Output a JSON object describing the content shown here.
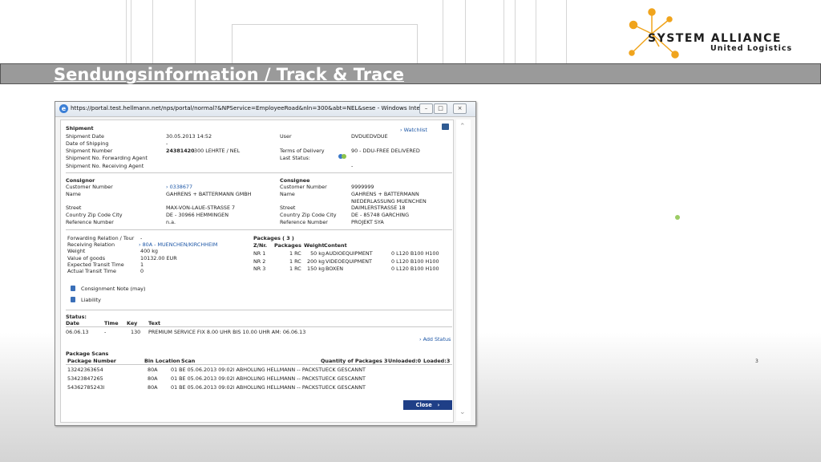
{
  "slide": {
    "title": "Sendungsinformation / Track & Trace",
    "logo": {
      "line1": "SYSTEM ALLIANCE",
      "line2": "United Logistics",
      "accent": "#f0a41c"
    },
    "tiny_text": "3"
  },
  "window": {
    "url": "https://portal.test.hellmann.net/nps/portal/normal?&NPService=EmployeeRoad&nln=300&abt=NEL&sese - Windows Inte...",
    "min": "–",
    "max": "□",
    "close": "×"
  },
  "shipment": {
    "heading": "Shipment",
    "links": {
      "watchlist": "Watchlist"
    },
    "labels": {
      "date": "Shipment Date",
      "shipping": "Date of Shipping",
      "number": "Shipment Number",
      "fwd": "Shipment No. Forwarding Agent",
      "rcv": "Shipment No. Receiving Agent",
      "user": "User",
      "terms": "Terms of Delivery",
      "last_status": "Last Status:"
    },
    "values": {
      "date": "30.05.2013  14:52",
      "shipping": "-",
      "number_bold": "24381420",
      "number_rest": "300 LEHRTE / NEL",
      "user": "DVDUEDVDUE",
      "terms": "90 - DDU-FREE DELIVERED",
      "last_status_dash": "-"
    }
  },
  "consignor": {
    "heading": "Consignor",
    "labels": {
      "customer": "Customer Number",
      "name": "Name",
      "street": "Street",
      "country": "Country Zip Code City",
      "reference": "Reference Number"
    },
    "values": {
      "customer": "0338677",
      "name": "GAHRENS + BATTERMANN GMBH",
      "street": "MAX-VON-LAUE-STRASSE 7",
      "country": "DE - 30966  HEMMINGEN",
      "reference": "n.a."
    }
  },
  "consignee": {
    "heading": "Consignee",
    "labels": {
      "customer": "Customer Number",
      "name": "Name",
      "street": "Street",
      "country": "Country Zip Code City",
      "reference": "Reference Number"
    },
    "values": {
      "customer": "9999999",
      "name1": "GAHRENS + BATTERMANN",
      "name2": "NIEDERLASSUNG MUENCHEN",
      "street": "DAIMLERSTRASSE 18",
      "country": "DE - 85748  GARCHING",
      "reference": "PROJEKT SYA"
    }
  },
  "forwarding": {
    "labels": {
      "relation": "Forwarding Relation / Tour",
      "receiving": "Receiving Relation",
      "weight": "Weight",
      "value": "Value of goods",
      "expected": "Expected Transit Time",
      "actual": "Actual Transit Time"
    },
    "values": {
      "relation": "-",
      "receiving": "80A - MUENCHEN/KIRCHHEIM",
      "weight": "400 kg",
      "value": "10132.00 EUR",
      "expected": "1",
      "actual": "0"
    }
  },
  "packages": {
    "heading": "Packages  ( 3 )",
    "headers": [
      "Z/Nr.",
      "Packages",
      "Weight",
      "Content"
    ],
    "rows": [
      {
        "nr": "NR 1",
        "pkg": "1 RC",
        "wt": "50 kg",
        "content": "AUDIOEQUIPMENT",
        "dims": "0 L120 B100 H100"
      },
      {
        "nr": "NR 2",
        "pkg": "1 RC",
        "wt": "200 kg",
        "content": "VIDEOEQUIPMENT",
        "dims": "0 L120 B100 H100"
      },
      {
        "nr": "NR 3",
        "pkg": "1 RC",
        "wt": "150 kg",
        "content": "BOXEN",
        "dims": "0 L120 B100 H100"
      }
    ]
  },
  "documents": {
    "consignment": "Consignment Note (may)",
    "liability": "Liability"
  },
  "status": {
    "heading": "Status:",
    "headers": [
      "Date",
      "Time",
      "Key",
      "Text"
    ],
    "row": {
      "date": "06.06.13",
      "time": "-",
      "key": "130",
      "text": "PREMIUM SERVICE FIX 8.00 UHR BIS 10.00 UHR AM: 06.06.13"
    },
    "add_link": "Add Status"
  },
  "scans": {
    "heading": "Package Scans",
    "headers": {
      "number": "Package Number",
      "bin": "Bin Location",
      "scan": "Scan",
      "qty": "Quantity of Packages 3",
      "unloaded": "Unloaded:0",
      "loaded": "Loaded:3"
    },
    "rows": [
      {
        "number": "13242363654",
        "bin": "80A",
        "scan": "01  BE 05.06.2013    09:02l ABHOLUNG HELLMANN -- PACKSTUECK GESCANNT"
      },
      {
        "number": "53423847265",
        "bin": "80A",
        "scan": "01  BE 05.06.2013    09:02l ABHOLUNG HELLMANN -- PACKSTUECK GESCANNT"
      },
      {
        "number": "54362785243l",
        "bin": "80A",
        "scan": "01  BE 05.06.2013    09:02l ABHOLUNG HELLMANN -- PACKSTUECK GESCANNT"
      }
    ]
  },
  "buttons": {
    "close": "Close"
  }
}
